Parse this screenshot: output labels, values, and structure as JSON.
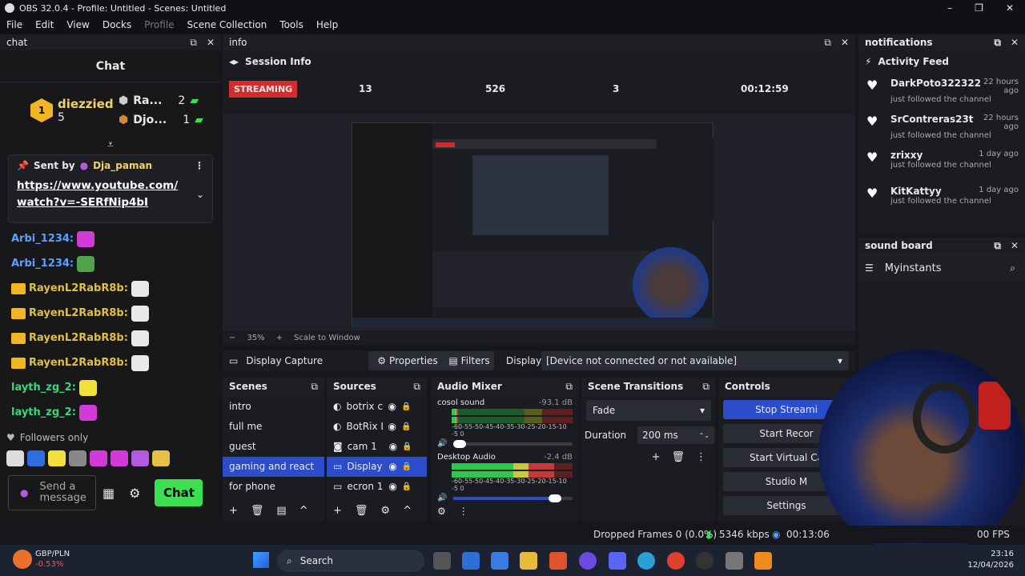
{
  "window": {
    "title": "OBS 32.0.4 - Profile: Untitled - Scenes: Untitled"
  },
  "menu": [
    "File",
    "Edit",
    "View",
    "Docks",
    "Profile",
    "Scene Collection",
    "Tools",
    "Help"
  ],
  "chat_dock": {
    "title": "chat",
    "header": "Chat",
    "leaders": [
      {
        "rank": "1",
        "name": "diezzied",
        "count": "5"
      },
      {
        "rank": "2",
        "name": "Ra...",
        "count": "2"
      },
      {
        "rank": "3",
        "name": "Djo...",
        "count": "1"
      }
    ],
    "pinned": {
      "sent_by_label": "Sent by",
      "author": "Dja_paman",
      "text": "https://www.youtube.com/watch?v=-SERfNip4bI"
    },
    "messages": [
      {
        "user": "Arbi_1234:",
        "color": "#5aa0ff",
        "emote": "#d33bd9"
      },
      {
        "user": "Arbi_1234:",
        "color": "#5aa0ff",
        "emote": "#4fa34a"
      },
      {
        "user": "RayenL2RabR8b:",
        "color": "#e0c040",
        "emote": "#e9e9e9"
      },
      {
        "user": "RayenL2RabR8b:",
        "color": "#e0c040",
        "emote": "#e9e9e9"
      },
      {
        "user": "RayenL2RabR8b:",
        "color": "#e0c040",
        "emote": "#e9e9e9"
      },
      {
        "user": "RayenL2RabR8b:",
        "color": "#e0c040",
        "emote": "#e9e9e9"
      },
      {
        "user": "layth_zg_2:",
        "color": "#3ad67a",
        "emote": "#f3e03a"
      },
      {
        "user": "layth_zg_2:",
        "color": "#3ad67a",
        "emote": "#d33bd9"
      }
    ],
    "followers_only": "Followers only",
    "input_placeholder": "Send a message",
    "chat_button": "Chat"
  },
  "info_dock": {
    "title": "info",
    "session_info": "Session Info",
    "status": "STREAMING",
    "stats": [
      "13",
      "526",
      "3",
      "00:12:59"
    ]
  },
  "preview": {
    "zoom": "35%",
    "scale_mode": "Scale to Window"
  },
  "source_bar": {
    "source": "Display Capture",
    "properties": "Properties",
    "filters": "Filters",
    "display_label": "Display",
    "display_value": "[Device not connected or not available]"
  },
  "scenes": {
    "title": "Scenes",
    "items": [
      "intro",
      "full me",
      "guest",
      "gaming and react",
      "for phone"
    ],
    "selected_index": 3
  },
  "sources": {
    "title": "Sources",
    "items": [
      {
        "name": "botrix cl",
        "icon": "browser-icon"
      },
      {
        "name": "BotRix L",
        "icon": "browser-icon"
      },
      {
        "name": "cam 1",
        "icon": "camera-icon"
      },
      {
        "name": "Display",
        "icon": "monitor-icon"
      },
      {
        "name": "ecron 1",
        "icon": "monitor-icon"
      }
    ],
    "selected_index": 3
  },
  "audio_mixer": {
    "title": "Audio Mixer",
    "channels": [
      {
        "name": "cosol sound",
        "db": "-93.1 dB",
        "level": 0.05
      },
      {
        "name": "Desktop Audio",
        "db": "-2.4 dB",
        "level": 0.85
      }
    ],
    "scale": "-60-55-50-45-40-35-30-25-20-15-10 -5 0"
  },
  "transitions": {
    "title": "Scene Transitions",
    "type": "Fade",
    "duration_label": "Duration",
    "duration_value": "200 ms"
  },
  "controls": {
    "title": "Controls",
    "buttons": [
      "Stop Streami",
      "Start Recor",
      "Start Virtual Ca",
      "Studio M",
      "Settings"
    ]
  },
  "notifications_dock": {
    "title": "notifications",
    "feed_title": "Activity Feed",
    "items": [
      {
        "name": "DarkPoto322322",
        "time": "22 hours ago",
        "action": "just followed the channel"
      },
      {
        "name": "SrContreras23t",
        "time": "22 hours ago",
        "action": "just followed the channel"
      },
      {
        "name": "zrixxy",
        "time": "1 day ago",
        "action": "just followed the channel"
      },
      {
        "name": "KitKattyy",
        "time": "1 day ago",
        "action": "just followed the channel"
      }
    ]
  },
  "soundboard_dock": {
    "title": "sound board",
    "header": "Myinstants"
  },
  "statusbar": {
    "dropped": "Dropped Frames 0 (0.0%)",
    "bitrate": "5346 kbps",
    "timer": "00:13:06",
    "fps": "00 FPS"
  },
  "taskbar": {
    "ticker": "GBP/PLN",
    "ticker_change": "-0.53%",
    "search": "Search",
    "time": "23:16",
    "date": "12/04/2026"
  },
  "colors": {
    "accent": "#2b4dcc",
    "streaming": "#d42c2c",
    "chat_button": "#3ae04f",
    "bg": "#16171c"
  }
}
